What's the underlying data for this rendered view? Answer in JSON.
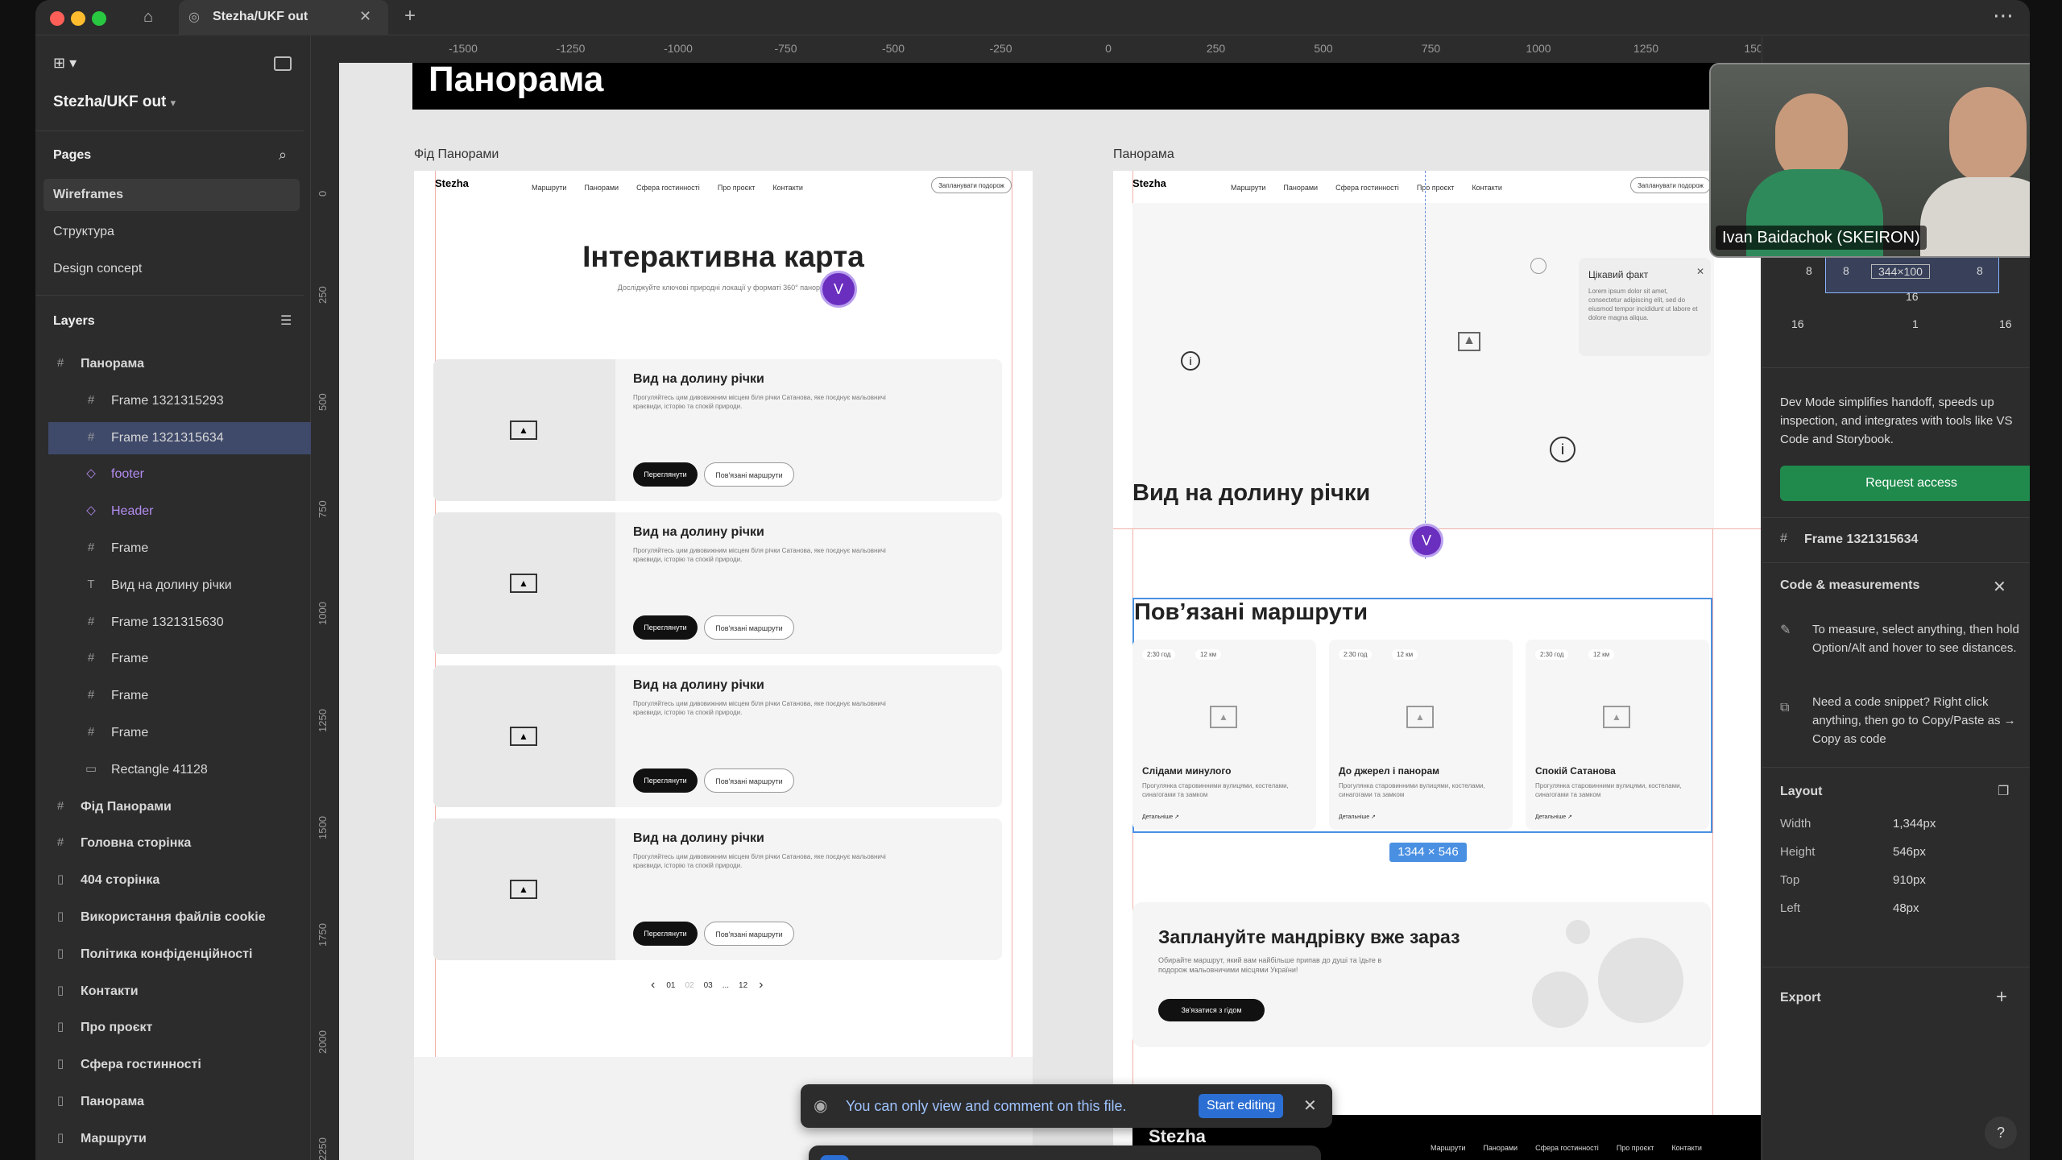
{
  "titlebar": {
    "tab_title": "Stezha/UKF out",
    "more": "⋯",
    "add_tab": "+",
    "close_tab": "✕"
  },
  "left_panel": {
    "file_name": "Stezha/UKF out",
    "pages_header": "Pages",
    "pages": [
      "Wireframes",
      "Структура",
      "Design concept"
    ],
    "layers_header": "Layers",
    "layers": [
      {
        "label": "Панорама",
        "icon": "#",
        "indent": 0,
        "bold": true
      },
      {
        "label": "Frame 1321315293",
        "icon": "#",
        "indent": 1
      },
      {
        "label": "Frame 1321315634",
        "icon": "#",
        "indent": 1,
        "selected": true
      },
      {
        "label": "footer",
        "icon": "◇",
        "indent": 1,
        "component": true
      },
      {
        "label": "Header",
        "icon": "◇",
        "indent": 1,
        "component": true
      },
      {
        "label": "Frame",
        "icon": "#",
        "indent": 1
      },
      {
        "label": "Вид на долину річки",
        "icon": "T",
        "indent": 1
      },
      {
        "label": "Frame 1321315630",
        "icon": "#",
        "indent": 1
      },
      {
        "label": "Frame",
        "icon": "#",
        "indent": 1
      },
      {
        "label": "Frame",
        "icon": "#",
        "indent": 1
      },
      {
        "label": "Frame",
        "icon": "#",
        "indent": 1
      },
      {
        "label": "Rectangle 41128",
        "icon": "▭",
        "indent": 1
      },
      {
        "label": "Фід Панорами",
        "icon": "#",
        "indent": 0,
        "bold": true
      },
      {
        "label": "Головна сторінка",
        "icon": "#",
        "indent": 0,
        "bold": true
      },
      {
        "label": "404 сторінка",
        "icon": "▯",
        "indent": 0,
        "bold": true
      },
      {
        "label": "Використання файлів cookie",
        "icon": "▯",
        "indent": 0,
        "bold": true
      },
      {
        "label": "Політика конфіденційності",
        "icon": "▯",
        "indent": 0,
        "bold": true
      },
      {
        "label": "Контакти",
        "icon": "▯",
        "indent": 0,
        "bold": true
      },
      {
        "label": "Про проєкт",
        "icon": "▯",
        "indent": 0,
        "bold": true
      },
      {
        "label": "Сфера гостинності",
        "icon": "▯",
        "indent": 0,
        "bold": true
      },
      {
        "label": "Панорама",
        "icon": "▯",
        "indent": 0,
        "bold": true
      },
      {
        "label": "Маршрути",
        "icon": "▯",
        "indent": 0,
        "bold": true
      }
    ]
  },
  "ruler": {
    "top": [
      "-1500",
      "-1250",
      "-1000",
      "-750",
      "-500",
      "-250",
      "0",
      "250",
      "500",
      "750",
      "1000",
      "1250",
      "150"
    ],
    "left": [
      "0",
      "250",
      "500",
      "750",
      "1000",
      "1250",
      "1500",
      "1750",
      "2000",
      "2250"
    ]
  },
  "canvas": {
    "top_title": "Панорама",
    "feed_label": "Фід Панорами",
    "panorama_label": "Панорама",
    "nav": [
      "Маршрути",
      "Панорами",
      "Сфера гостинності",
      "Про проєкт",
      "Контакти"
    ],
    "nav_cta": "Запланувати подорож",
    "logo": "Stezha",
    "map_title": "Інтерактивна карта",
    "map_subtitle": "Досліджуйте ключові природні локації у форматі 360° панорам",
    "card_title": "Вид на долину річки",
    "card_text": "Прогуляйтесь цим дивовижним місцем біля річки Сатанова, яке поєднує мальовничі краєвиди, історію та спокій природи.",
    "btn_view": "Переглянути",
    "btn_routes": "Пов'язані маршрути",
    "pagination": [
      "01",
      "02",
      "03",
      "...",
      "12"
    ],
    "avatar": "V",
    "fact_title": "Цікавий факт",
    "fact_text": "Lorem ipsum dolor sit amet, consectetur adipiscing elit, sed do eiusmod tempor incididunt ut labore et dolore magna aliqua.",
    "valley_heading": "Вид на долину річки",
    "related_heading": "Пов’язані маршрути",
    "chip_time": "2:30 год",
    "chip_dist": "12 км",
    "route_cards": [
      {
        "title": "Слідами минулого",
        "text": "Прогулянка старовинними вулицями, костелами, синагогами та замком"
      },
      {
        "title": "До джерел і панорам",
        "text": "Прогулянка старовинними вулицями, костелами, синагогами та замком"
      },
      {
        "title": "Спокій Сатанова",
        "text": "Прогулянка старовинними вулицями, костелами, синагогами та замком"
      }
    ],
    "details_link": "Детальніше ↗",
    "selection_size": "1344 × 546",
    "plan_heading": "Заплануйте мандрівку вже зараз",
    "plan_text": "Обирайте маршрут, який вам найбільше припав до душі та їдьте в подорож мальовничими місцями України!",
    "plan_cta": "Зв'язатися з гідом",
    "footer_nav": [
      "Маршрути",
      "Панорами",
      "Сфера гостинності",
      "Про проєкт",
      "Контакти"
    ]
  },
  "toast": {
    "text": "You can only view and comment on this file.",
    "action": "Start editing"
  },
  "right_panel": {
    "spacing": {
      "top": "8",
      "right": "8",
      "size": "344×100",
      "bottom": "16",
      "outer_left": "16",
      "outer_right": "16",
      "outer_bottom": "1"
    },
    "devmode_text": "Dev Mode simplifies handoff, speeds up inspection, and integrates with tools like VS Code and Storybook.",
    "request_access": "Request access",
    "frame_name": "Frame 1321315634",
    "code_header": "Code & measurements",
    "tip1": "To measure, select anything, then hold Option/Alt and hover to see distances.",
    "tip2": "Need a code snippet? Right click anything, then go to Copy/Paste as → Copy as code",
    "layout_header": "Layout",
    "layout": [
      {
        "k": "Width",
        "v": "1,344px"
      },
      {
        "k": "Height",
        "v": "546px"
      },
      {
        "k": "Top",
        "v": "910px"
      },
      {
        "k": "Left",
        "v": "48px"
      }
    ],
    "export_header": "Export",
    "help": "?"
  },
  "webcam": {
    "name": "Ivan Baidachok (SKEIRON)"
  }
}
